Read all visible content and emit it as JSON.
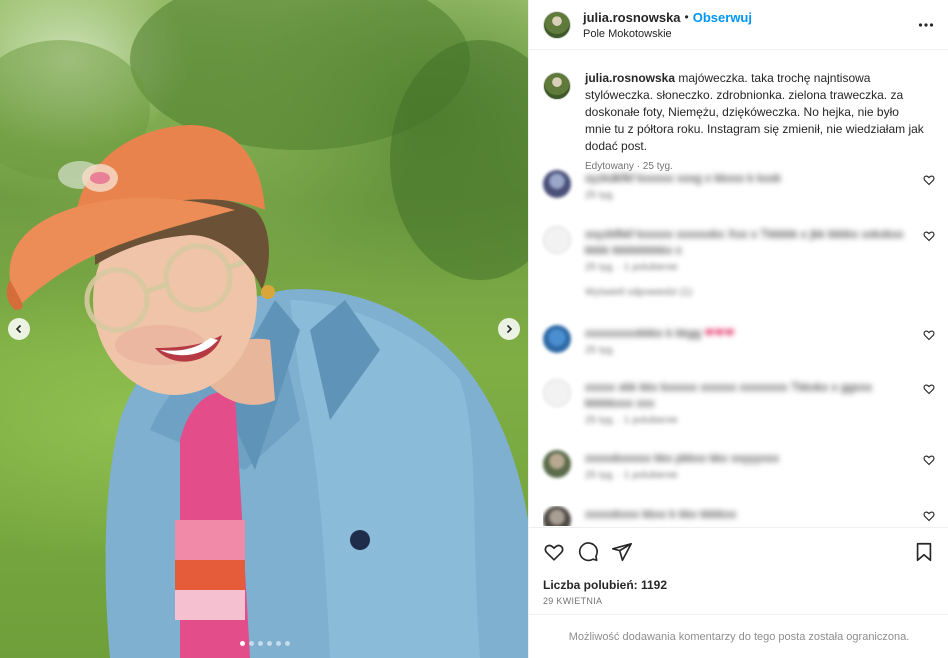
{
  "photo": {
    "description_icons": {
      "prev": "chevron-left-icon",
      "next": "chevron-right-icon"
    },
    "carousel_dots": 6,
    "carousel_active": 0
  },
  "header": {
    "username": "julia.rosnowska",
    "bullet": "•",
    "follow_label": "Obserwuj",
    "location": "Pole Mokotowskie"
  },
  "caption": {
    "username": "julia.rosnowska",
    "text": "majóweczka. taka trochę najntisowa stylóweczka. słoneczko. zdrobnionka. zielona traweczka. za doskonałe foty, Niemężu, dziękóweczka. No hejka, nie było mnie tu z półtora roku. Instagram się zmienił, nie wiedziałam jak dodać post.",
    "meta": "Edytowany · 25 tyg."
  },
  "comments": [
    {
      "text": "xyzkdkfkf kxxxxx xxxg x kkxxx k kxxk",
      "meta": "25 tyg."
    },
    {
      "text": "xxyzkfkkf kxxxxx xxxxxxkx Xxx x Tkkkkk x jkk kkkkx xxkxkxx kkkk kkkkkkkkkx x",
      "meta": "25 tyg. · 1 polubienie",
      "reply": "Wyświetl odpowiedzi (1)"
    },
    {
      "text": "xxxxxxxxxkkkx k kkgg",
      "meta": "25 tyg."
    },
    {
      "text": "xxxxx xkk kkx kxxxxx xxxxxx xxxxxxxx Tkkxkx x ggxxx kkkkkxxx xxx",
      "meta": "25 tyg. · 1 polubienie"
    },
    {
      "text": "xxxxxkxxxxx kkx pkkxx kkx xxyyyxxx",
      "meta": "25 tyg. · 1 polubienie"
    },
    {
      "text": "xxxxxkxxx kkxx k kkx kkkkxx",
      "meta": ""
    }
  ],
  "actions": {
    "likes_label": "Liczba polubień: 1192",
    "date": "29 KWIETNIA"
  },
  "restricted_text": "Możliwość dodawania komentarzy do tego posta została ograniczona.",
  "colors": {
    "follow": "#0095f6",
    "muted": "#737373",
    "border": "#efefef"
  }
}
